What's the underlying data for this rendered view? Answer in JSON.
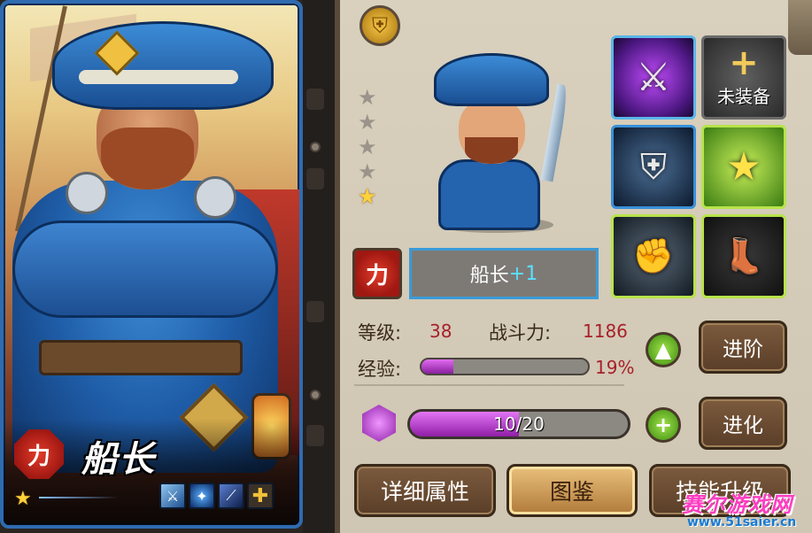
{
  "hero": {
    "name": "船长",
    "type_label": "力",
    "stars": 1,
    "skill_icons": [
      "sword-slash-icon",
      "blue-flame-icon",
      "twin-blade-icon",
      "plus-icon"
    ]
  },
  "detail": {
    "max_stars": 5,
    "lit_stars": 1,
    "type_label": "力",
    "name": "船长",
    "plus_level": "+1",
    "equipment": [
      {
        "name": "crossed-swords-icon",
        "label": ""
      },
      {
        "name": "add-equipment-icon",
        "label": "未装备"
      },
      {
        "name": "plate-armor-icon",
        "label": ""
      },
      {
        "name": "star-wand-icon",
        "label": ""
      },
      {
        "name": "gauntlet-icon",
        "label": ""
      },
      {
        "name": "boot-icon",
        "label": ""
      }
    ]
  },
  "stats": {
    "level_label": "等级:",
    "level_value": "38",
    "power_label": "战斗力:",
    "power_value": "1186",
    "exp_label": "经验:",
    "exp_percent_text": "19%",
    "exp_fraction": 0.19
  },
  "buttons": {
    "advance_label": "进阶",
    "evolve_label": "进化",
    "details_tab": "详细属性",
    "codex_tab": "图鉴",
    "skill_tab": "技能升级"
  },
  "evolution": {
    "text": "10/20",
    "fraction": 0.5
  },
  "watermark": {
    "title": "赛尔游戏网",
    "url": "www.51saier.cn"
  },
  "colors": {
    "accent_blue": "#2f6bb0",
    "type_red": "#e23b2a",
    "stat_red": "#a8202a",
    "exp_purple": "#c84ee0",
    "active_tab": "#e9c07c"
  }
}
